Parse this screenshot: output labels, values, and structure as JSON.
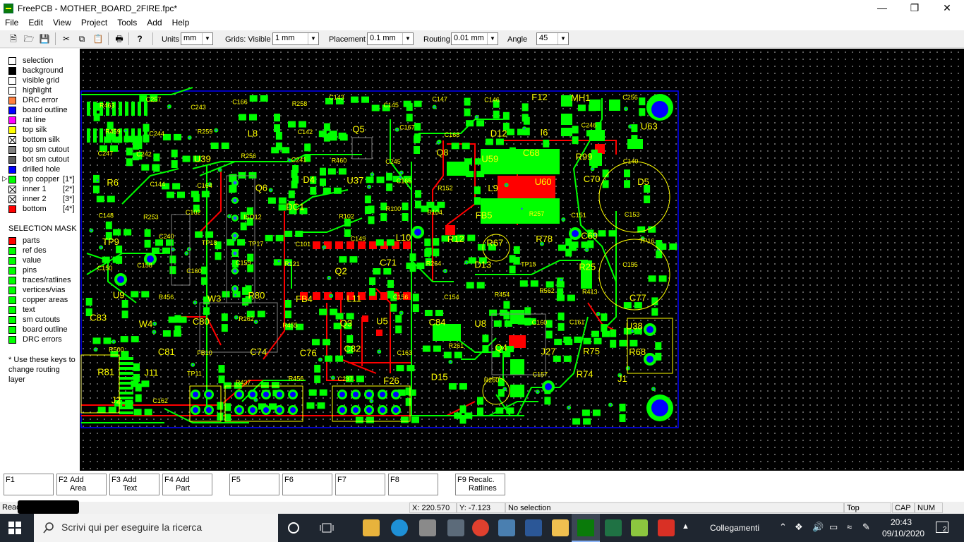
{
  "window": {
    "title": "FreePCB - MOTHER_BOARD_2FIRE.fpc*"
  },
  "menu": [
    "File",
    "Edit",
    "View",
    "Project",
    "Tools",
    "Add",
    "Help"
  ],
  "toolbar": {
    "units_label": "Units",
    "units_value": "mm",
    "grids_label": "Grids: Visible",
    "grids_value": "1 mm",
    "placement_label": "Placement",
    "placement_value": "0.1 mm",
    "routing_label": "Routing",
    "routing_value": "0.01 mm",
    "angle_label": "Angle",
    "angle_value": "45"
  },
  "layers": [
    {
      "name": "selection",
      "color": "#ffffff",
      "num": ""
    },
    {
      "name": "background",
      "color": "#000000",
      "num": ""
    },
    {
      "name": "visible grid",
      "color": "#ffffff",
      "num": ""
    },
    {
      "name": "highlight",
      "color": "#ffffff",
      "num": ""
    },
    {
      "name": "DRC error",
      "color": "#ff8040",
      "num": ""
    },
    {
      "name": "board outline",
      "color": "#0000ff",
      "num": ""
    },
    {
      "name": "rat line",
      "color": "#ff00ff",
      "num": ""
    },
    {
      "name": "top silk",
      "color": "#ffff00",
      "num": ""
    },
    {
      "name": "bottom silk",
      "color": "#ffffff",
      "num": "",
      "crossed": true
    },
    {
      "name": "top sm cutout",
      "color": "#808080",
      "num": ""
    },
    {
      "name": "bot sm cutout",
      "color": "#606060",
      "num": ""
    },
    {
      "name": "drilled hole",
      "color": "#0000ff",
      "num": ""
    },
    {
      "name": "top copper",
      "color": "#00ff00",
      "num": "[1*]"
    },
    {
      "name": "inner 1",
      "color": "#ffffff",
      "num": "[2*]",
      "crossed": true
    },
    {
      "name": "inner 2",
      "color": "#ffffff",
      "num": "[3*]",
      "crossed": true
    },
    {
      "name": "bottom",
      "color": "#ff0000",
      "num": "[4*]"
    }
  ],
  "selection_mask": {
    "title": "SELECTION MASK",
    "items": [
      {
        "name": "parts",
        "color": "#ff0000"
      },
      {
        "name": "ref des",
        "color": "#00ff00"
      },
      {
        "name": "value",
        "color": "#00ff00"
      },
      {
        "name": "pins",
        "color": "#00ff00"
      },
      {
        "name": "traces/ratlines",
        "color": "#00ff00"
      },
      {
        "name": "vertices/vias",
        "color": "#00ff00"
      },
      {
        "name": "copper areas",
        "color": "#00ff00"
      },
      {
        "name": "text",
        "color": "#00ff00"
      },
      {
        "name": "sm cutouts",
        "color": "#00ff00"
      },
      {
        "name": "board outline",
        "color": "#00ff00"
      },
      {
        "name": "DRC errors",
        "color": "#00ff00"
      }
    ],
    "note": "* Use these keys to change routing layer"
  },
  "pcb_labels": [
    "R463",
    "C257",
    "C243",
    "C166",
    "R258",
    "C143",
    "C145",
    "C147",
    "C146",
    "F12",
    "MH1",
    "C256",
    "R459",
    "C244",
    "R259",
    "L8",
    "C142",
    "Q5",
    "C167",
    "C168",
    "D12",
    "I6",
    "C246",
    "U63",
    "C247",
    "C242",
    "U39",
    "R256",
    "C241",
    "R460",
    "C245",
    "Q8",
    "U59",
    "C68",
    "R99",
    "C140",
    "R6",
    "C144",
    "C164",
    "Q6",
    "D4",
    "U37",
    "C165",
    "R152",
    "L9",
    "U60",
    "C70",
    "D5",
    "C148",
    "R253",
    "C102",
    "ISO12",
    "DC1",
    "R102",
    "R100",
    "R104",
    "FB5",
    "R257",
    "C151",
    "C153",
    "TP9",
    "C240",
    "TP18",
    "TP17",
    "C101",
    "C149",
    "L10",
    "R12",
    "R67",
    "R78",
    "C69",
    "TP16",
    "C150",
    "C158",
    "C160",
    "C159",
    "R121",
    "Q2",
    "C71",
    "R264",
    "D13",
    "TP15",
    "R25",
    "C155",
    "U9",
    "R456",
    "W3",
    "R80",
    "FB4",
    "L11",
    "C156",
    "C154",
    "R454",
    "R562",
    "R413",
    "C77",
    "C83",
    "W4",
    "C80",
    "R262",
    "R455",
    "Q3",
    "U5",
    "C84",
    "U8",
    "C160",
    "C161",
    "U38",
    "R500",
    "C81",
    "FB10",
    "C74",
    "C76",
    "C82",
    "C163",
    "R261",
    "Q4",
    "J27",
    "R75",
    "R68",
    "R81",
    "J11",
    "TP11",
    "R437",
    "R456",
    "C237",
    "F26",
    "D15",
    "R260",
    "C157",
    "R74",
    "J1",
    "J2",
    "C162"
  ],
  "fkeys": [
    {
      "key": "F1",
      "line1": "",
      "line2": ""
    },
    {
      "key": "F2",
      "line1": "Add",
      "line2": "Area"
    },
    {
      "key": "F3",
      "line1": "Add",
      "line2": "Text"
    },
    {
      "key": "F4",
      "line1": "Add",
      "line2": "Part"
    },
    {
      "key": "F5",
      "line1": "",
      "line2": ""
    },
    {
      "key": "F6",
      "line1": "",
      "line2": ""
    },
    {
      "key": "F7",
      "line1": "",
      "line2": ""
    },
    {
      "key": "F8",
      "line1": "",
      "line2": ""
    },
    {
      "key": "F9",
      "line1": "Recalc.",
      "line2": "Ratlines"
    }
  ],
  "status": {
    "left": "Read",
    "x_label": "X:",
    "x_value": "220.570",
    "y_label": "Y:",
    "y_value": "-7.123",
    "selection": "No selection",
    "layer": "Top",
    "cap": "CAP",
    "num": "NUM"
  },
  "taskbar": {
    "search_placeholder": "Scrivi qui per eseguire la ricerca",
    "links_label": "Collegamenti",
    "time": "20:43",
    "date": "09/10/2020",
    "notification_count": "2"
  }
}
